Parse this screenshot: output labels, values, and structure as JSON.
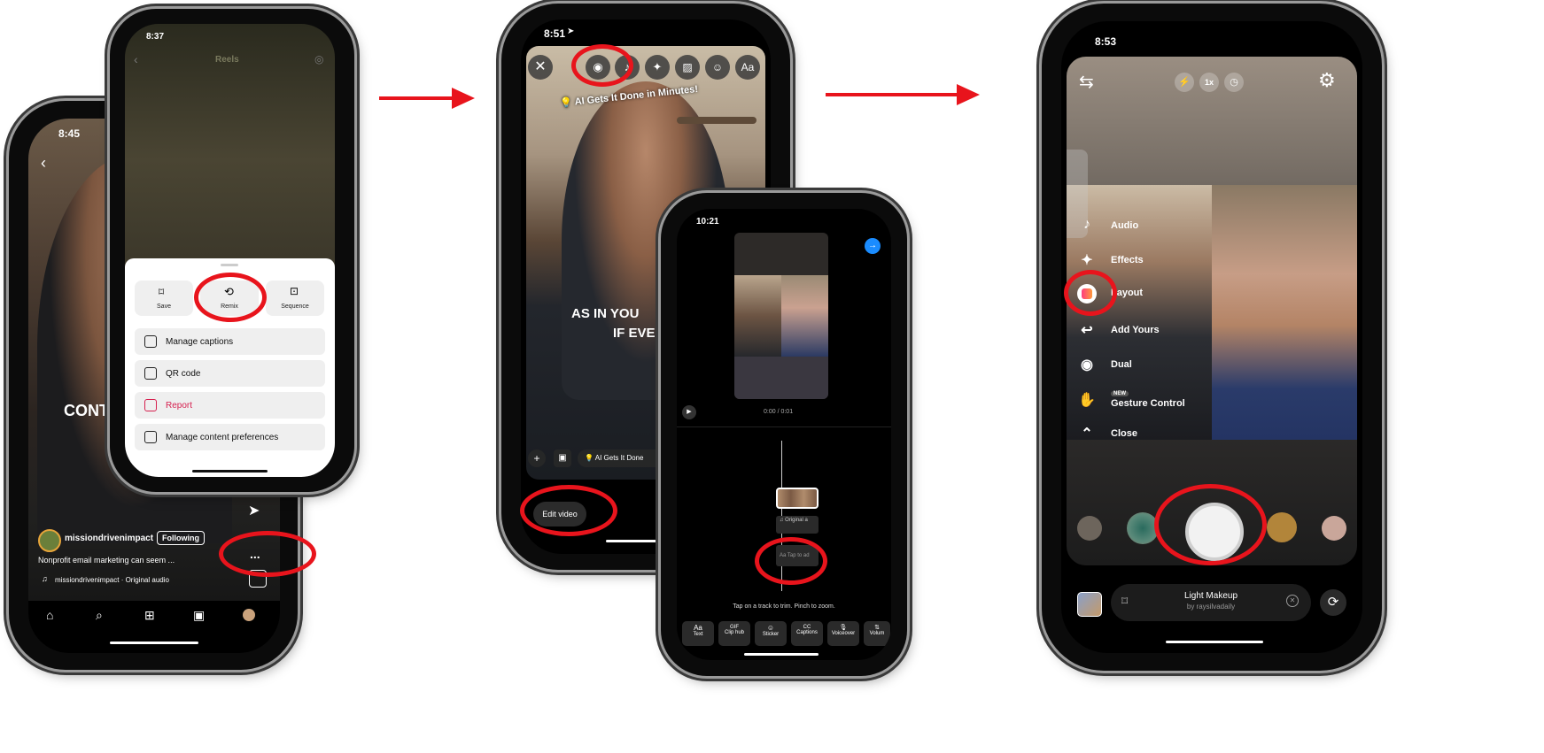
{
  "phone1": {
    "time": "8:45",
    "overlay_text": "CONT",
    "username": "missiondrivenimpact",
    "follow_label": "Following",
    "caption": "Nonprofit email marketing can seem ...",
    "audio": "missiondrivenimpact · Original audio",
    "more_label": "..."
  },
  "phone2": {
    "time": "8:37",
    "title": "Reels",
    "actions": [
      {
        "label": "Save",
        "icon": "bookmark-icon"
      },
      {
        "label": "Remix",
        "icon": "remix-icon"
      },
      {
        "label": "Sequence",
        "icon": "sequence-icon"
      }
    ],
    "rows": [
      {
        "label": "Manage captions",
        "icon": "captions-icon"
      },
      {
        "label": "QR code",
        "icon": "qr-code-icon"
      },
      {
        "label": "Report",
        "icon": "report-icon"
      },
      {
        "label": "Manage content preferences",
        "icon": "preferences-icon"
      }
    ],
    "report_color": "#d6204f"
  },
  "phone3": {
    "time": "8:51",
    "sticker_text": "AI Gets It Done in Minutes!",
    "overlay_text_1": "AS IN YOU",
    "overlay_text_2": "IF EVE",
    "tool_icons": [
      "close-icon",
      "camera-icon",
      "music-icon",
      "sparkles-icon",
      "image-icon",
      "sticker-icon",
      "text-icon"
    ],
    "text_tool_label": "Aa",
    "chip_label": "AI Gets It Done",
    "edit_video_label": "Edit video"
  },
  "phone4": {
    "time": "10:21",
    "timecode": "0:00",
    "duration": "/ 0:01",
    "audio_track": "Original a",
    "text_track": "Tap to ad",
    "hint": "Tap on a track to trim. Pinch to zoom.",
    "tools": [
      {
        "label": "Text",
        "glyph": "Aa"
      },
      {
        "label": "Clip hub",
        "glyph": "GIF"
      },
      {
        "label": "Sticker",
        "glyph": "☺"
      },
      {
        "label": "Captions",
        "glyph": "CC"
      },
      {
        "label": "Voiceover",
        "glyph": "🎙"
      },
      {
        "label": "Volum",
        "glyph": "⇅"
      }
    ],
    "accent": "#1a8cff"
  },
  "phone5": {
    "time": "8:53",
    "zoom_label": "1x",
    "menu": [
      {
        "label": "Audio",
        "icon": "audio-icon"
      },
      {
        "label": "Effects",
        "icon": "effects-icon"
      },
      {
        "label": "Layout",
        "icon": "layout-icon"
      },
      {
        "label": "Add Yours",
        "icon": "add-yours-icon"
      },
      {
        "label": "Dual",
        "icon": "dual-camera-icon"
      },
      {
        "label": "Gesture Control",
        "icon": "hand-icon",
        "badge": "NEW"
      },
      {
        "label": "Close",
        "icon": "chevron-up-icon"
      }
    ],
    "effect_name": "Light Makeup",
    "effect_author": "by raysilvadaily"
  },
  "annotation_color": "#e8141c"
}
